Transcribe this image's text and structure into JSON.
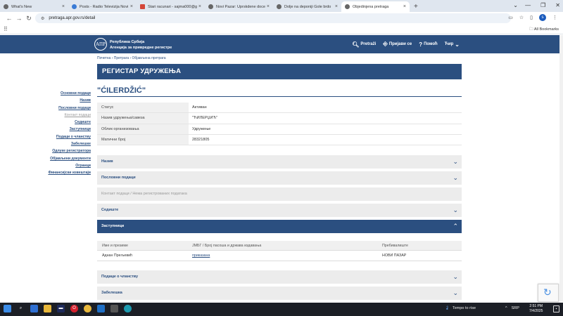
{
  "browser": {
    "tabs": [
      {
        "label": "What's New",
        "active": false
      },
      {
        "label": "Posts - Radio Televizija Novi Pa",
        "active": false
      },
      {
        "label": "Stari racunari - sajma000@gm",
        "active": false
      },
      {
        "label": "Novi Pazar: Uprskdene docenti",
        "active": false
      },
      {
        "label": "Dolje na deponiji Gole brdo",
        "active": false
      },
      {
        "label": "Objedinjena pretraga",
        "active": true
      }
    ],
    "new_tab": "+",
    "url": "pretraga.apr.gov.rs/detail",
    "profile_initial": "s",
    "all_bookmarks": "All Bookmarks"
  },
  "header": {
    "logo_text": "АПР",
    "org_line1": "Република Србија",
    "org_line2": "Агенција за привредне регистре",
    "nav": {
      "search": "Pretraži",
      "login": "Пријави се",
      "help": "Помоћ",
      "lang": "Ћир"
    }
  },
  "breadcrumb": "Почетна › Претрага › Објављена претрага",
  "banner_title": "РЕГИСТАР УДРУЖЕЊА",
  "left_nav": [
    {
      "label": "Основни подаци",
      "dim": false
    },
    {
      "label": "Назив",
      "dim": false
    },
    {
      "label": "Пословни подаци",
      "dim": false
    },
    {
      "label": "Контакт подаци",
      "dim": true
    },
    {
      "label": "Седиште",
      "dim": false
    },
    {
      "label": "Заступници",
      "dim": false
    },
    {
      "label": "Подаци о чланству",
      "dim": false
    },
    {
      "label": "Забелешке",
      "dim": false
    },
    {
      "label": "Одлуке регистратора",
      "dim": false
    },
    {
      "label": "Објављени документи",
      "dim": false
    },
    {
      "label": "Огранци",
      "dim": false
    },
    {
      "label": "Финансијски извештаји",
      "dim": false
    }
  ],
  "entity": {
    "name": "\"ĆILERDŽIĆ\"",
    "rows": [
      {
        "key": "Статус",
        "value": "Активан"
      },
      {
        "key": "Назив удружења/савеза",
        "value": "\"ЋИЛЕРЏИЋ\""
      },
      {
        "key": "Облик организовања",
        "value": "Удружење"
      },
      {
        "key": "Матични број",
        "value": "28321805"
      }
    ]
  },
  "sections": {
    "naziv": "Назив",
    "poslovni": "Пословни подаци",
    "kontakt": "Контакт подаци / Нема регистрованих података",
    "sediste": "Седиште",
    "zastupnici": "Заступници",
    "clanstvo": "Подаци о чланству",
    "zabeleske": "Забелешка"
  },
  "representatives": {
    "headers": [
      "Име и презиме",
      "ЈМБГ / Број пасоша и држава издавања",
      "Пребивалиште"
    ],
    "rows": [
      {
        "name": "Аднан Прељевић",
        "id": "приказана",
        "residence": "НОВИ ПАЗАР"
      }
    ]
  },
  "taskbar": {
    "weather": "Tempo to rise",
    "lang": "SRP",
    "time": "2:51 PM",
    "date": "7/4/2025"
  },
  "colors": {
    "brand": "#2b4f80",
    "section_bg": "#ececec"
  }
}
